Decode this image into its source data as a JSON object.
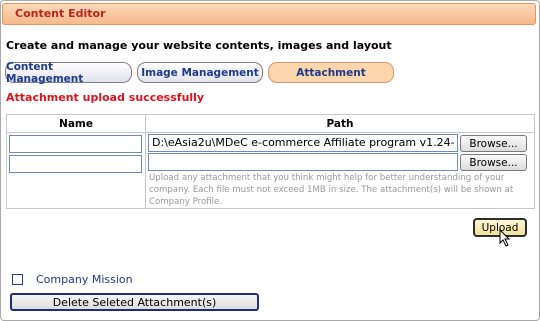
{
  "header": {
    "title": "Content Editor"
  },
  "intro": {
    "text": "Create and manage your website contents, images and layout"
  },
  "tabs": [
    {
      "label": "Content Management"
    },
    {
      "label": "Image Management"
    },
    {
      "label": "Attachment"
    }
  ],
  "status": {
    "message": "Attachment upload successfully"
  },
  "table": {
    "headers": {
      "name": "Name",
      "path": "Path"
    },
    "rows": [
      {
        "name": "",
        "path": "D:\\eAsia2u\\MDeC e-commerce Affiliate program v1.24-",
        "browse_label": "Browse..."
      },
      {
        "name": "",
        "path": "",
        "browse_label": "Browse..."
      }
    ],
    "help_text": "Upload any attachment that you think might help for better understanding of your company. Each file must not exceed  1MB in size. The attachment(s) will be shown at Company Profile."
  },
  "upload_label": "Upload",
  "attachments": [
    {
      "label": "Company Mission",
      "checked": false
    }
  ],
  "delete_label": "Delete Seleted Attachment(s)",
  "colors": {
    "accent": "#c0251d",
    "tab_active": "#fbd6ad",
    "status": "#e0121b",
    "link": "#1f3a8a"
  }
}
